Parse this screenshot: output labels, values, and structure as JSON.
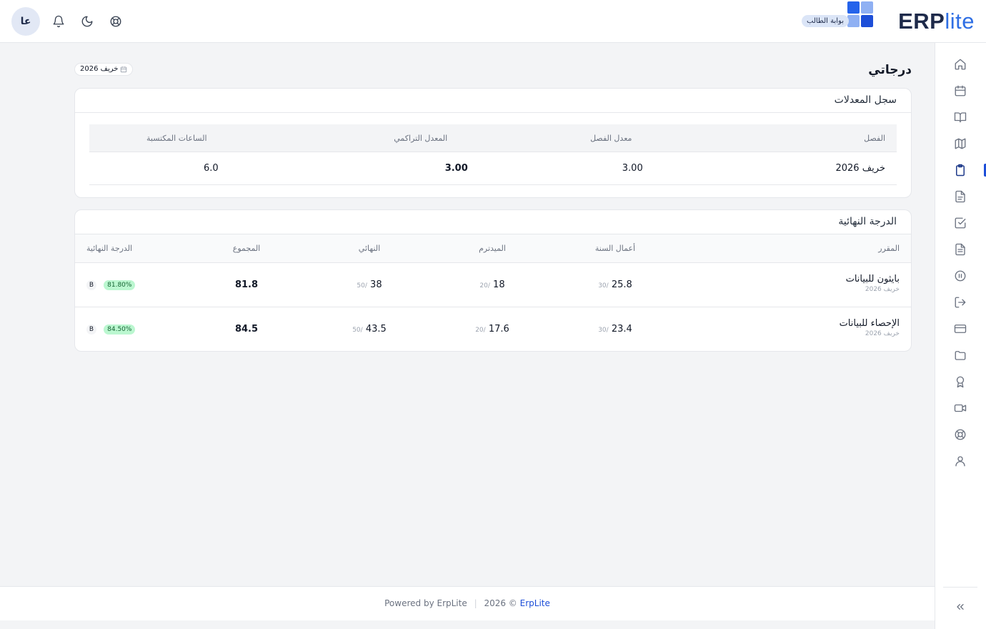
{
  "header": {
    "logo_main": "ERP",
    "logo_suffix": "lite",
    "portal_badge": "بوابة الطالب",
    "avatar_initials": "عا",
    "brand_colors": {
      "dark": "#1e2a4a",
      "blue": "#2f6fe4",
      "light_blue": "#8fb0f3"
    }
  },
  "sidebar": {
    "icons": [
      "home-icon",
      "calendar-icon",
      "book-icon",
      "map-icon",
      "clipboard-icon",
      "document-icon",
      "check-square-icon",
      "file-text-icon",
      "pause-circle-icon",
      "logout-icon",
      "credit-card-icon",
      "folder-icon",
      "award-icon",
      "video-icon",
      "lifebuoy-icon",
      "user-icon"
    ],
    "active_index": 4,
    "collapse_icon": "chevrons-left-icon"
  },
  "page": {
    "title": "درجاتي",
    "term_chip": "خريف 2026"
  },
  "gpa_card": {
    "title": "سجل المعدلات",
    "headers": [
      "الفصل",
      "معدل الفصل",
      "المعدل التراكمي",
      "الساعات المكتسبة"
    ],
    "rows": [
      {
        "term": "خريف 2026",
        "term_gpa": "3.00",
        "cumulative_gpa": "3.00",
        "earned_hours": "6.0"
      }
    ]
  },
  "grades_card": {
    "title": "الدرجة النهائية",
    "headers": [
      "المقرر",
      "أعمال السنة",
      "الميدترم",
      "النهائي",
      "المجموع",
      "الدرجة النهائية"
    ],
    "rows": [
      {
        "course": "بايثون للبيانات",
        "term": "خريف 2026",
        "annual": "25.8",
        "annual_max": "/30",
        "midterm": "18",
        "midterm_max": "/20",
        "final": "38",
        "final_max": "/50",
        "total": "81.8",
        "percent": "81.80%",
        "letter": "B"
      },
      {
        "course": "الإحصاء للبيانات",
        "term": "خريف 2026",
        "annual": "23.4",
        "annual_max": "/30",
        "midterm": "17.6",
        "midterm_max": "/20",
        "final": "43.5",
        "final_max": "/50",
        "total": "84.5",
        "percent": "84.50%",
        "letter": "B"
      }
    ]
  },
  "footer": {
    "powered": "Powered by ErpLite",
    "separator": "|",
    "copyright": "2026 ©",
    "brand": "ErpLite"
  }
}
